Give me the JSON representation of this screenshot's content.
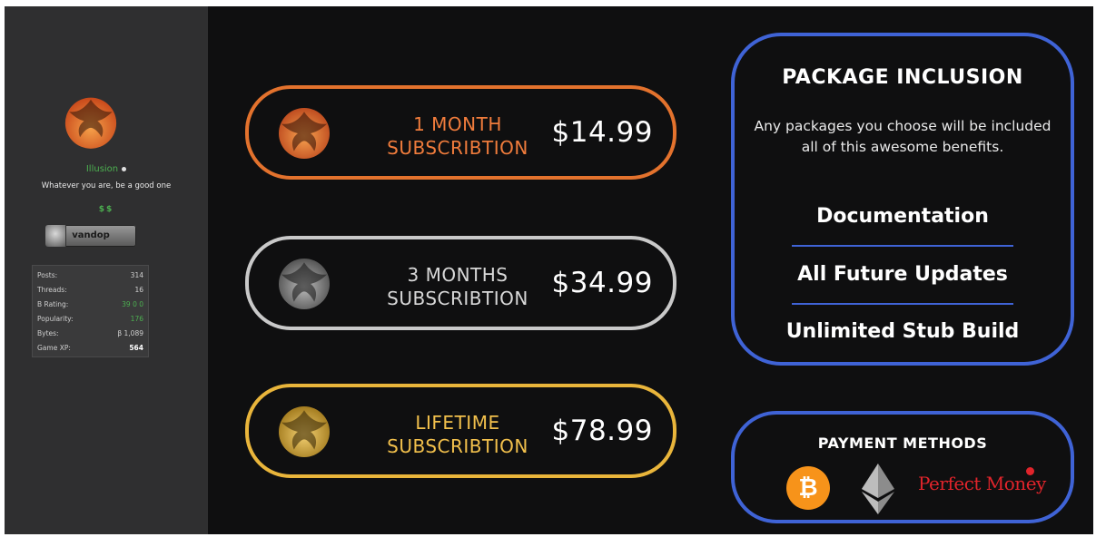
{
  "profile": {
    "username": "Illusion",
    "user_title": "Whatever you are, be a good one",
    "reputation_mark": "$$",
    "userbar_text": "vandop",
    "stats": [
      {
        "label": "Posts:",
        "value": "314"
      },
      {
        "label": "Threads:",
        "value": "16"
      },
      {
        "label": "B Rating:",
        "value": "39 0 0"
      },
      {
        "label": "Popularity:",
        "value": "176"
      },
      {
        "label": "Bytes:",
        "value": "β 1,089"
      },
      {
        "label": "Game XP:",
        "value": "564"
      }
    ]
  },
  "plans": [
    {
      "line1": "1 MONTH",
      "line2": "SUBSCRIBTION",
      "price": "$14.99",
      "color": "#e3722d",
      "logo": "phoenix-icon"
    },
    {
      "line1": "3 MONTHS",
      "line2": "SUBSCRIBTION",
      "price": "$34.99",
      "color": "#c9c9c9",
      "logo": "phoenix-icon"
    },
    {
      "line1": "LIFETIME",
      "line2": "SUBSCRIBTION",
      "price": "$78.99",
      "color": "#e9b53b",
      "logo": "phoenix-icon"
    }
  ],
  "inclusion": {
    "title": "PACKAGE INCLUSION",
    "description": "Any packages you choose will be included all of this awesome benefits.",
    "benefits": [
      "Documentation",
      "All Future Updates",
      "Unlimited Stub Build"
    ]
  },
  "payment": {
    "title": "PAYMENT METHODS",
    "methods": [
      "bitcoin-icon",
      "ethereum-icon",
      "Perfect Money"
    ]
  },
  "colors": {
    "accent_blue": "#3f63d6",
    "background": "#0f0f10",
    "sidebar": "#2f2f30"
  }
}
